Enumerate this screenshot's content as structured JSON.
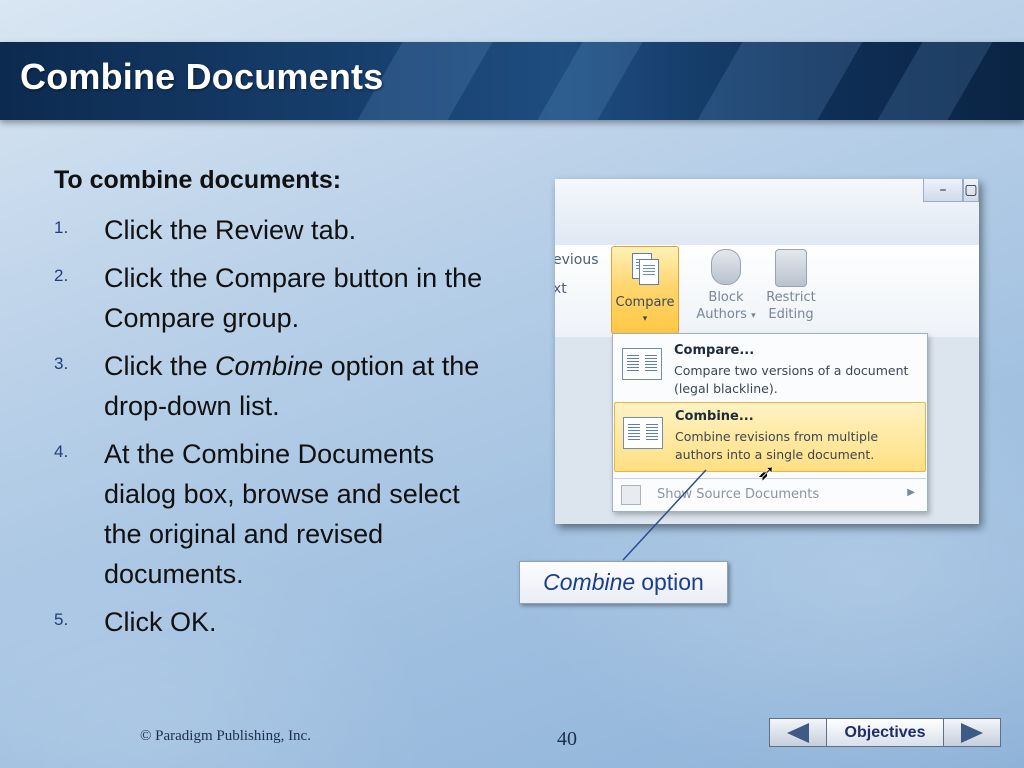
{
  "slide": {
    "title": "Combine Documents",
    "steps_heading": "To combine documents:",
    "steps": [
      {
        "num": "1.",
        "text": "Click the Review tab."
      },
      {
        "num": "2.",
        "text": "Click the Compare button in the Compare group."
      },
      {
        "num": "3.",
        "text_before": "Click the ",
        "text_em": "Combine",
        "text_after": " option at the drop-down list."
      },
      {
        "num": "4.",
        "text": "At the Combine Documents dialog box, browse and select the original and revised documents."
      },
      {
        "num": "5.",
        "text": "Click OK."
      }
    ]
  },
  "screenshot": {
    "side_labels": [
      "evious",
      "xt"
    ],
    "compare_button": {
      "label": "Compare",
      "caret": "▾"
    },
    "block_authors": {
      "line1": "Block",
      "line2": "Authors",
      "caret": "▾"
    },
    "restrict_editing": {
      "line1": "Restrict",
      "line2": "Editing"
    },
    "menu": {
      "compare": {
        "title": "Compare...",
        "desc": "Compare two versions of a document (legal blackline)."
      },
      "combine": {
        "title": "Combine...",
        "desc": "Combine revisions from multiple authors into a single document."
      },
      "show_source": {
        "label": "Show Source Documents",
        "arrow": "▶"
      }
    },
    "window_buttons": [
      "–",
      "▢"
    ]
  },
  "callout": {
    "em": "Combine",
    "text": "option"
  },
  "footer": {
    "copyright": "© Paradigm Publishing, Inc.",
    "page_number": "40",
    "nav_label": "Objectives"
  },
  "colors": {
    "title_bar": "#173f6d",
    "highlight": "#ffd66e",
    "callout_text": "#1a3f8a"
  }
}
